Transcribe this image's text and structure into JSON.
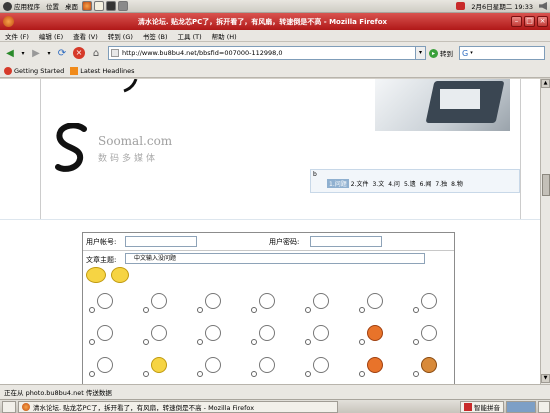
{
  "top_panel": {
    "applications": "应用程序",
    "places": "位置",
    "desktop": "桌面",
    "clock": "2月6日星期二 19:33"
  },
  "window": {
    "title": "清水论坛. 贴龙芯PC了，拆开看了，有风扇，转速倒是不高 - Mozilla Firefox"
  },
  "menu": [
    "文件 (F)",
    "编辑 (E)",
    "查看 (V)",
    "转到 (G)",
    "书签 (B)",
    "工具 (T)",
    "帮助 (H)"
  ],
  "navigation": {
    "url": "http://www.bu8bu4.net/bbsfid=007000-112998,0",
    "go_label": "转到"
  },
  "bookmarks": [
    "Getting Started",
    "Latest Headlines"
  ],
  "banner": {
    "brand_en": "Soomal.com",
    "brand_cn": "数码多媒体"
  },
  "forum_tabs": {
    "first": "b",
    "items": [
      "1.问题",
      "2.文件",
      "3.文",
      "4.问",
      "5.遗",
      "6.闻",
      "7.独",
      "8.物"
    ]
  },
  "form": {
    "username_label": "用户帐号:",
    "password_label": "用户密码:",
    "subject_label": "文章主题:",
    "subject_value": "中文输入没问题"
  },
  "status": {
    "text": "正在从 photo.bu8bu4.net 传送数据"
  },
  "taskbar": {
    "window_item": "清水论坛. 贴龙芯PC了，拆开看了，有风扇，转速倒是不高 - Mozilla Firefox",
    "ime_label": "智能拼音"
  },
  "colors": {
    "title_red": "#c0201c",
    "form_border": "#8c8c8c",
    "active_tab": "#8fb0d0"
  }
}
